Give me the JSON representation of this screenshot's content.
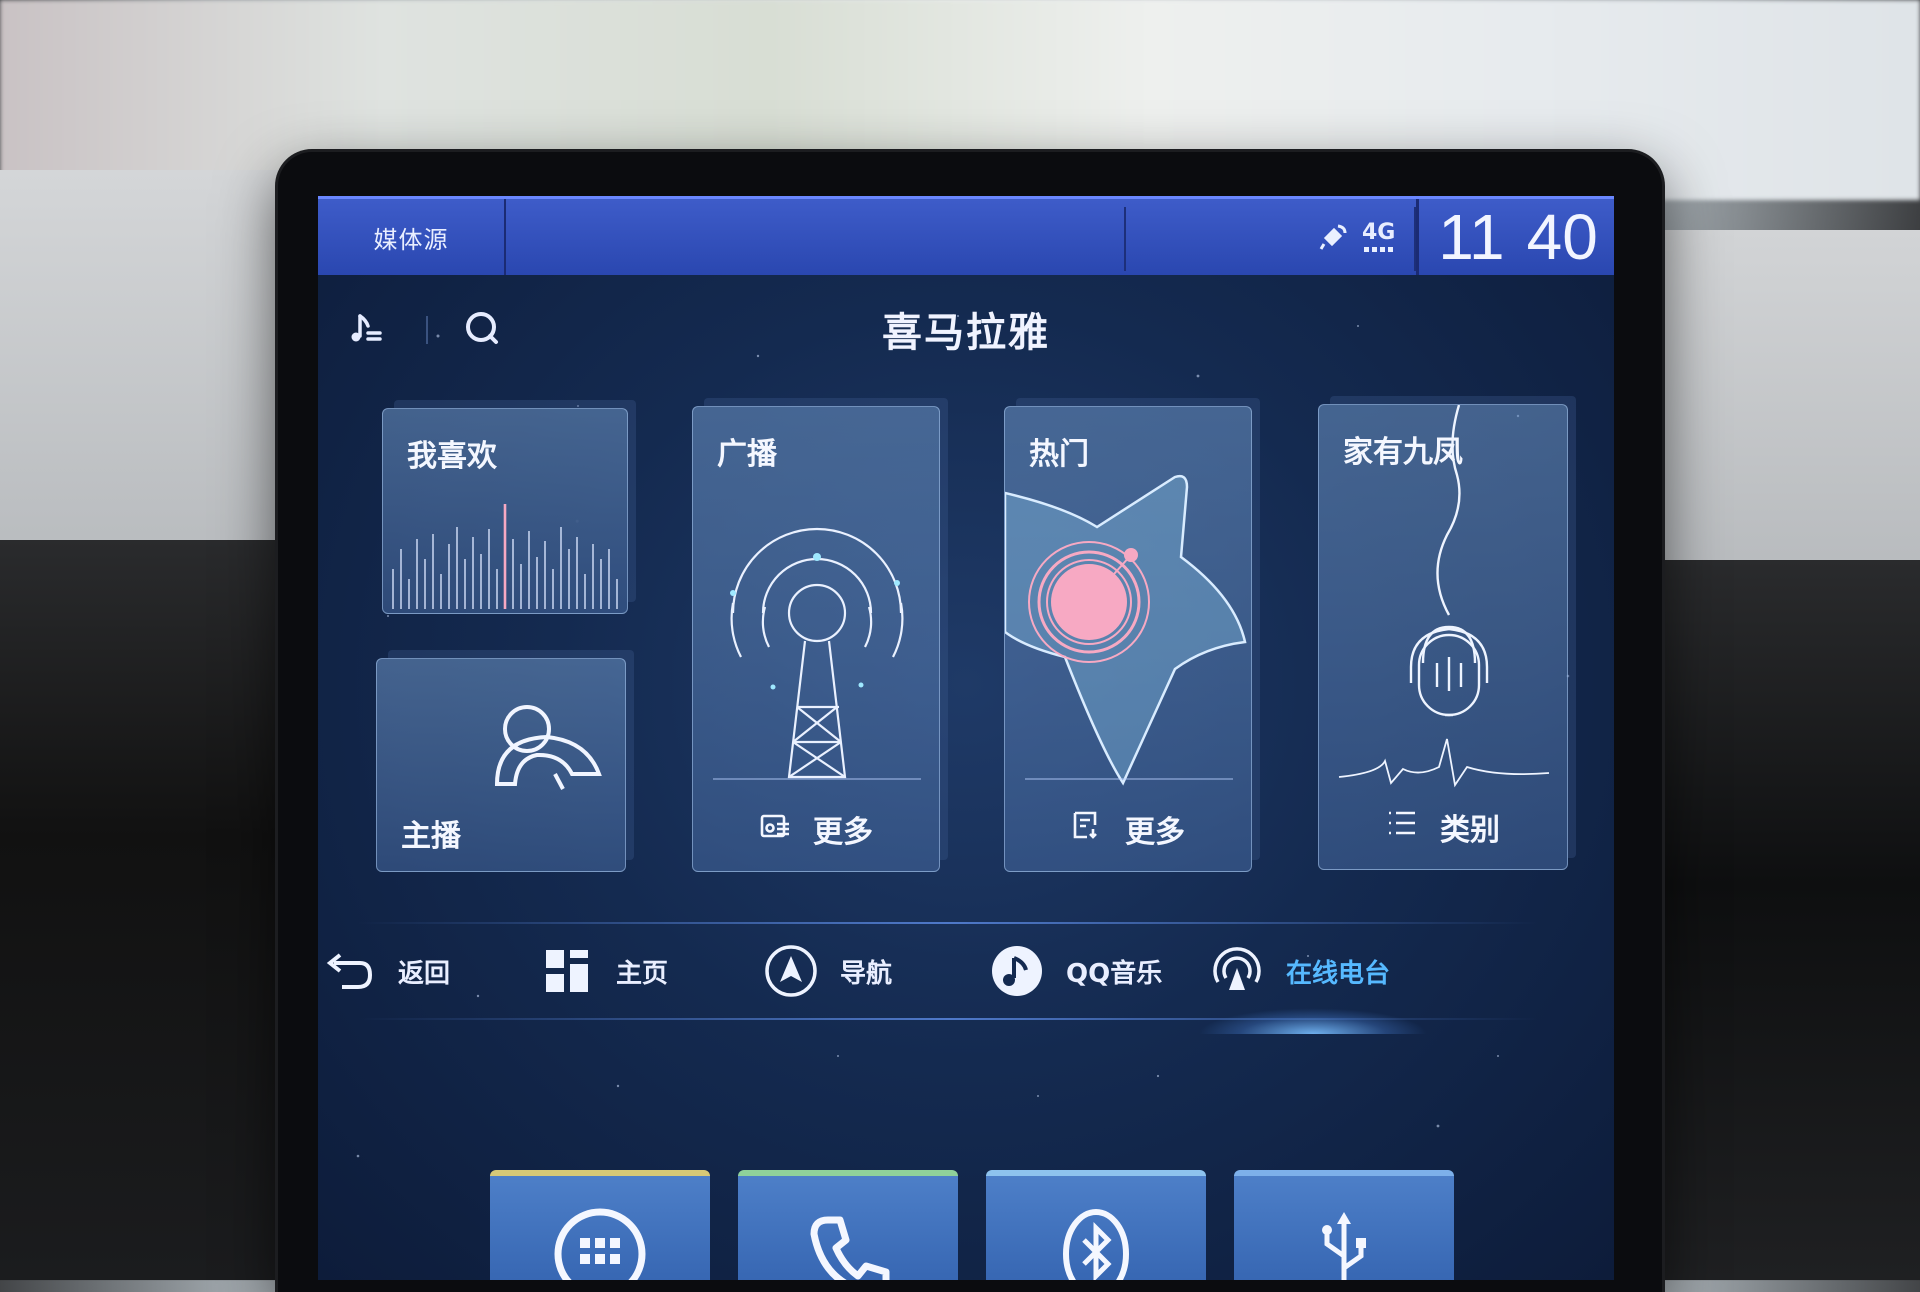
{
  "status_bar": {
    "media_source_label": "媒体源",
    "network_label": "4G",
    "clock_hour": "11",
    "clock_minute": "40"
  },
  "header": {
    "title": "喜马拉雅",
    "icons": [
      "music-list-icon",
      "search-icon"
    ]
  },
  "cards": {
    "favorites": {
      "label": "我喜欢"
    },
    "anchor": {
      "label": "主播"
    },
    "broadcast": {
      "label": "广播",
      "more_label": "更多"
    },
    "hot": {
      "label": "热门",
      "more_label": "更多"
    },
    "jiayoujiufeng": {
      "label": "家有九凤",
      "category_label": "类别"
    }
  },
  "navbar": {
    "items": [
      {
        "label": "返回",
        "icon": "back-icon"
      },
      {
        "label": "主页",
        "icon": "home-grid-icon"
      },
      {
        "label": "导航",
        "icon": "navigation-icon"
      },
      {
        "label": "QQ音乐",
        "icon": "qq-music-icon"
      },
      {
        "label": "在线电台",
        "icon": "online-radio-icon",
        "active": true
      }
    ]
  },
  "dock": {
    "tiles": [
      "apps-grid-icon",
      "phone-icon",
      "bluetooth-icon",
      "usb-icon"
    ]
  },
  "colors": {
    "status_bar": "#2f4cb8",
    "screen_bg": "#142a50",
    "active_nav": "#56b9ff",
    "card_accent_pink": "#f7a9c3"
  }
}
